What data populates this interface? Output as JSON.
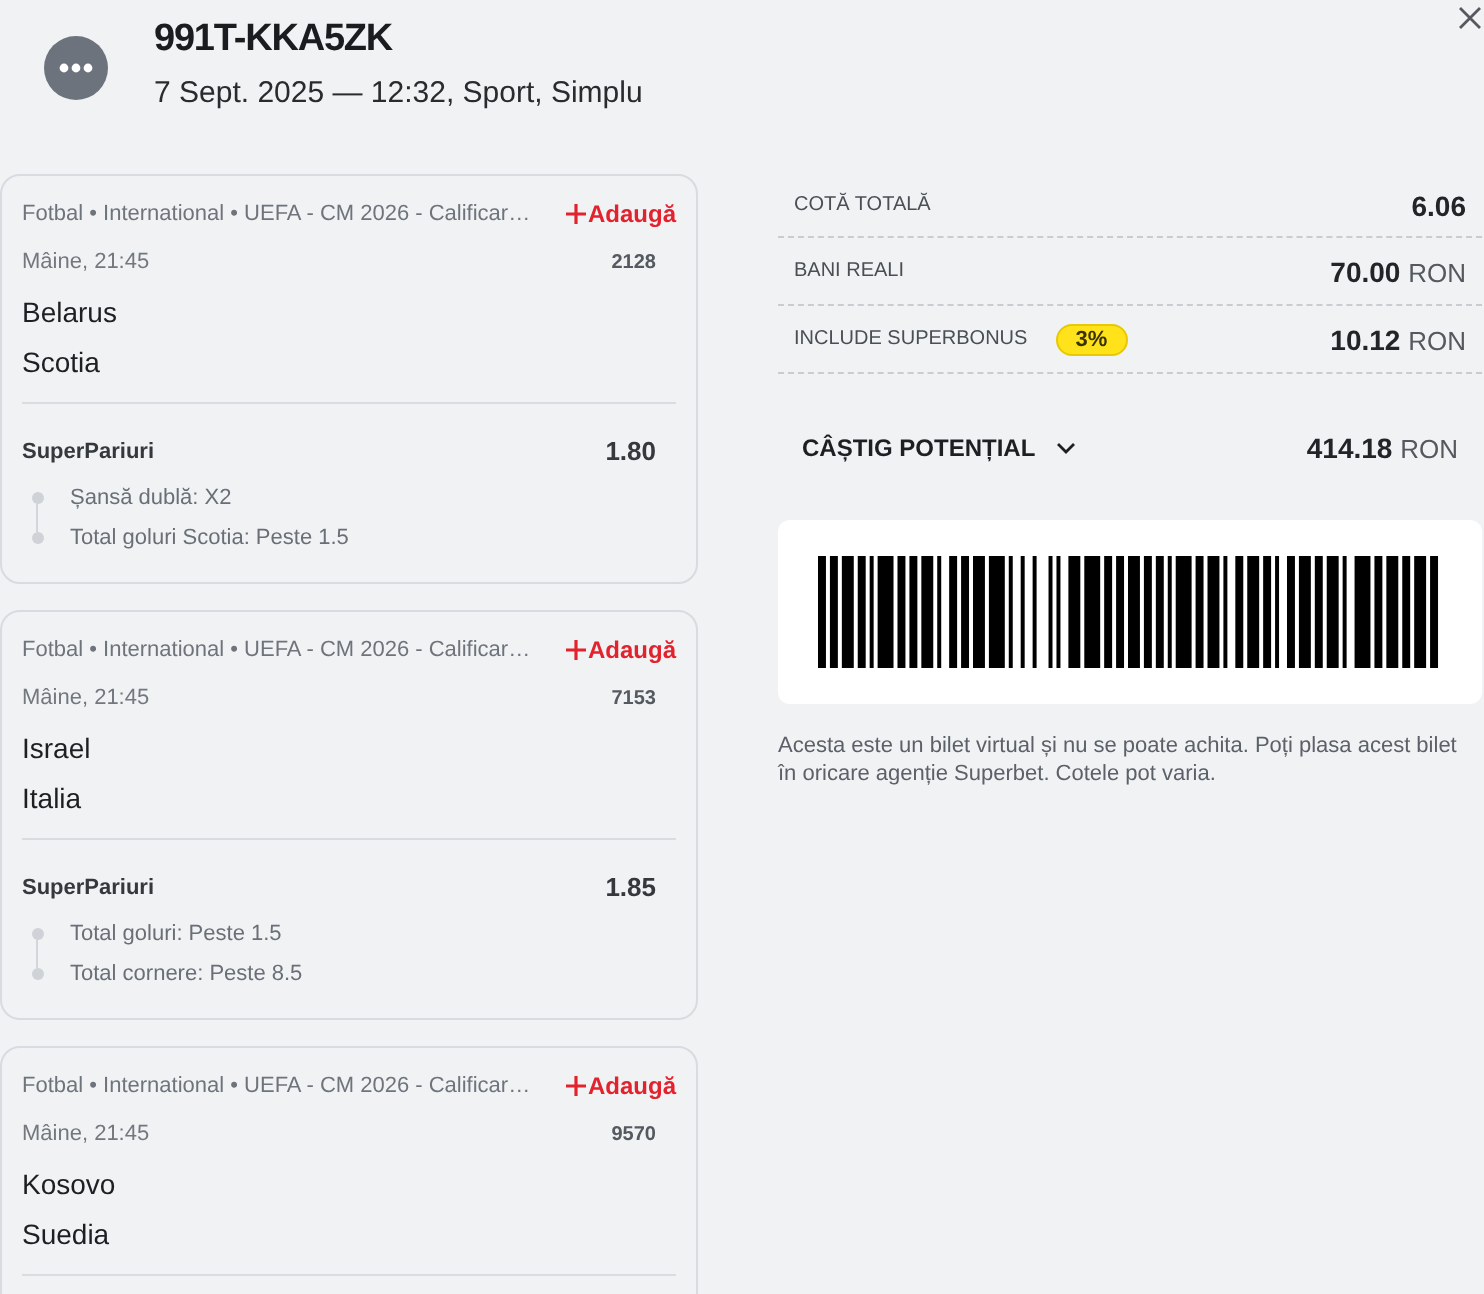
{
  "header": {
    "title": "991T-KKA5ZK",
    "subtitle": "7 Sept. 2025 — 12:32, Sport, Simplu"
  },
  "events": [
    {
      "breadcrumb": "Fotbal • International • UEFA - CM 2026 - Calificar…",
      "add_label": "Adaugă",
      "time": "Mâine, 21:45",
      "code": "2128",
      "teams": [
        "Belarus",
        "Scotia"
      ],
      "market": "SuperPariuri",
      "odds": "1.80",
      "selections": [
        "Șansă dublă: X2",
        "Total goluri Scotia: Peste 1.5"
      ]
    },
    {
      "breadcrumb": "Fotbal • International • UEFA - CM 2026 - Calificar…",
      "add_label": "Adaugă",
      "time": "Mâine, 21:45",
      "code": "7153",
      "teams": [
        "Israel",
        "Italia"
      ],
      "market": "SuperPariuri",
      "odds": "1.85",
      "selections": [
        "Total goluri: Peste 1.5",
        "Total cornere: Peste 8.5"
      ]
    },
    {
      "breadcrumb": "Fotbal • International • UEFA - CM 2026 - Calificar…",
      "add_label": "Adaugă",
      "time": "Mâine, 21:45",
      "code": "9570",
      "teams": [
        "Kosovo",
        "Suedia"
      ]
    }
  ],
  "summary": {
    "rows": [
      {
        "label": "COTĂ TOTALĂ",
        "value": "6.06"
      },
      {
        "label": "BANI REALI",
        "value": "70.00",
        "unit": "RON"
      },
      {
        "label": "INCLUDE SUPERBONUS",
        "badge": "3%",
        "value": "10.12",
        "unit": "RON"
      }
    ],
    "potential": {
      "label": "CÂȘTIG POTENȚIAL",
      "expanded": false,
      "value": "414.18",
      "unit": "RON"
    }
  },
  "note": "Acesta este un bilet virtual și nu se poate achita. Poți plasa acest bilet în oricare agenție Superbet. Cotele pot varia."
}
